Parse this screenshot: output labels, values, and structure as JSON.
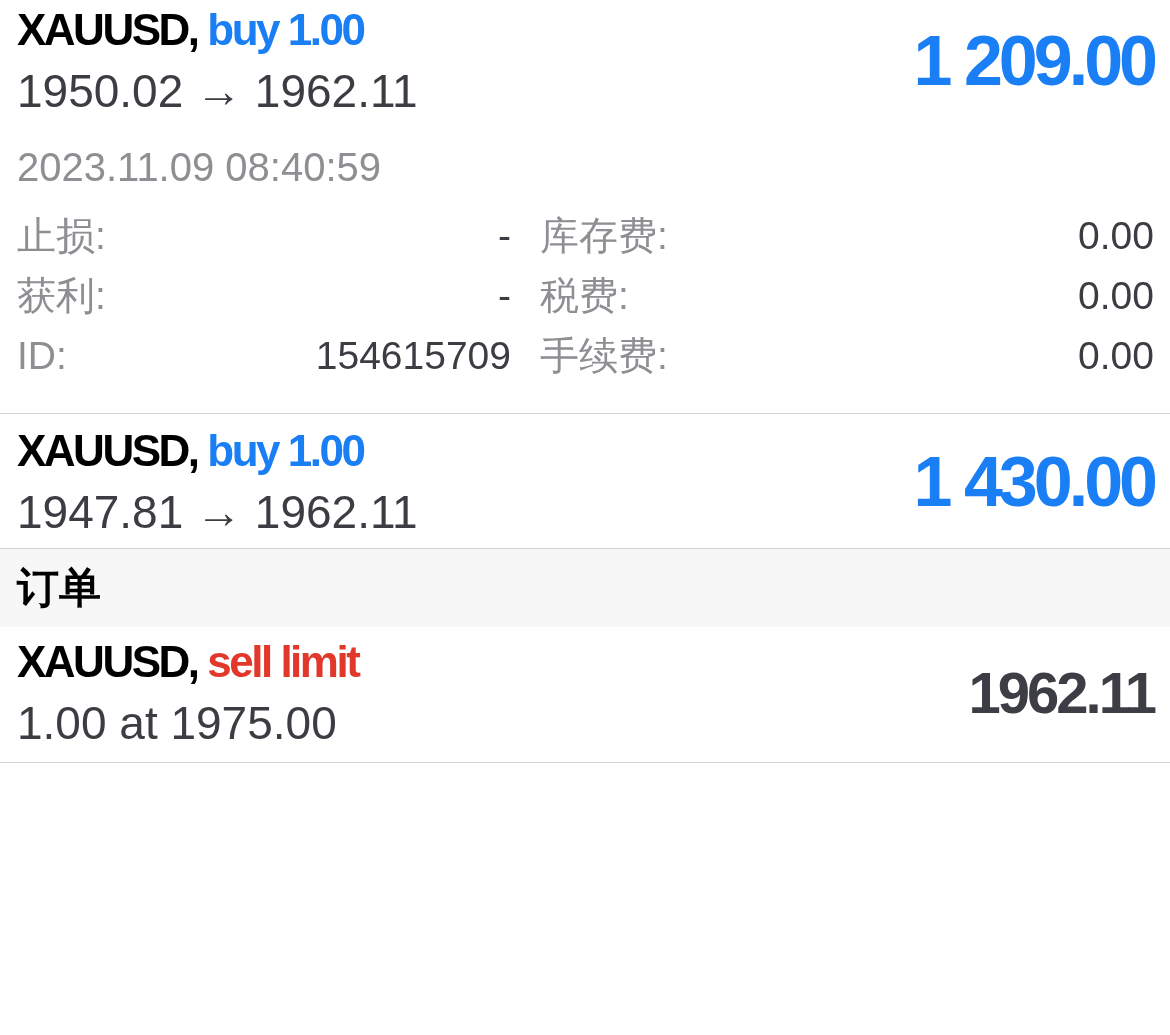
{
  "positions": [
    {
      "symbol": "XAUUSD,",
      "side": "buy 1.00",
      "kind": "buy",
      "prices": "1950.02 → 1962.11",
      "profit": "1 209.00",
      "time": "2023.11.09 08:40:59",
      "details": [
        {
          "cells": [
            "止损:",
            "-",
            "库存费:",
            "0.00"
          ]
        },
        {
          "cells": [
            "获利:",
            "-",
            "税费:",
            "0.00"
          ]
        },
        {
          "cells": [
            "ID:",
            "154615709",
            "手续费:",
            "0.00"
          ]
        }
      ]
    },
    {
      "symbol": "XAUUSD,",
      "side": "buy 1.00",
      "kind": "buy",
      "prices": "1947.81 → 1962.11",
      "profit": "1 430.00"
    }
  ],
  "orders_header": "订单",
  "orders": [
    {
      "symbol": "XAUUSD,",
      "side": "sell limit",
      "kind": "sell",
      "prices": "1.00 at 1975.00",
      "price": "1962.11"
    }
  ]
}
